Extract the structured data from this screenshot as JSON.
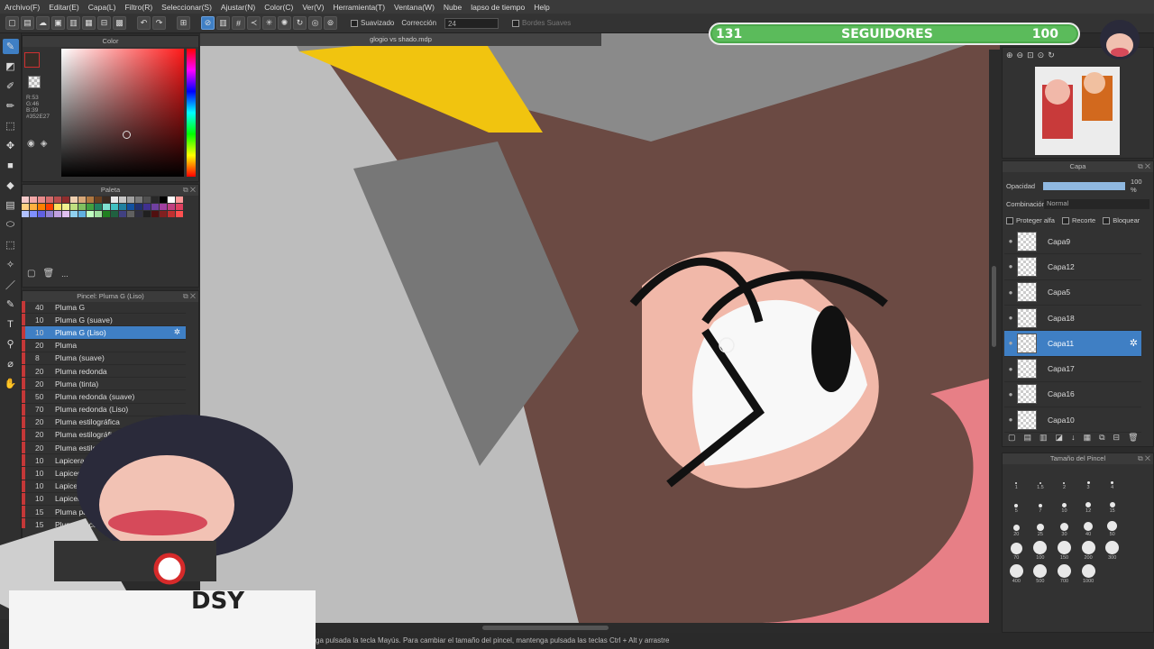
{
  "menu": [
    "Archivo(F)",
    "Editar(E)",
    "Capa(L)",
    "Filtro(R)",
    "Seleccionar(S)",
    "Ajustar(N)",
    "Color(C)",
    "Ver(V)",
    "Herramienta(T)",
    "Ventana(W)",
    "Nube",
    "lapso de tiempo",
    "Help"
  ],
  "command_bar": {
    "smoothing_label": "Suavizado",
    "correction_label": "Corrección",
    "correction_value": "24",
    "soft_edges_label": "Bordes Suaves"
  },
  "color_panel": {
    "title": "Color",
    "readout": [
      "R:53",
      "G:46",
      "B:39",
      "#352E27"
    ],
    "main_color": "#352e27"
  },
  "palette_panel": {
    "title": "Paleta",
    "colors": [
      "#f4c9c9",
      "#f2a8a8",
      "#e88b8b",
      "#d46b6b",
      "#b94d4d",
      "#8f2d2d",
      "#f0d0b0",
      "#d8a878",
      "#b07840",
      "#6a4020",
      "#3a2a20",
      "#e8e8e8",
      "#c8c8c8",
      "#a0a0a0",
      "#787878",
      "#505050",
      "#282828",
      "#000000",
      "#ffffff",
      "#ff9999",
      "#ffd080",
      "#ffb040",
      "#ff8000",
      "#ff4000",
      "#ffe060",
      "#f0f090",
      "#c0e080",
      "#80c060",
      "#40a040",
      "#208060",
      "#80e0d0",
      "#40c0c0",
      "#2080a0",
      "#1050a0",
      "#203070",
      "#403090",
      "#7040a0",
      "#a040a0",
      "#c04080",
      "#e04060",
      "#b0c0ff",
      "#8090ff",
      "#6060e0",
      "#9080d0",
      "#c0a0e0",
      "#e0c0f0",
      "#90d0f0",
      "#60b0e0",
      "#c0ffc0",
      "#a0e0a0",
      "#208020",
      "#206040",
      "#404080",
      "#606060",
      "#303040",
      "#202020",
      "#501010",
      "#802020",
      "#c03030",
      "#ff5050"
    ],
    "more_label": "..."
  },
  "brush_panel": {
    "title": "Pincel: Pluma G (Liso)",
    "items": [
      {
        "size": "40",
        "name": "Pluma G"
      },
      {
        "size": "10",
        "name": "Pluma G (suave)"
      },
      {
        "size": "10",
        "name": "Pluma G (Liso)"
      },
      {
        "size": "20",
        "name": "Pluma"
      },
      {
        "size": "8",
        "name": "Pluma (suave)"
      },
      {
        "size": "20",
        "name": "Pluma redonda"
      },
      {
        "size": "20",
        "name": "Pluma (tinta)"
      },
      {
        "size": "50",
        "name": "Pluma redonda (suave)"
      },
      {
        "size": "70",
        "name": "Pluma redonda (Liso)"
      },
      {
        "size": "20",
        "name": "Pluma estilográfica"
      },
      {
        "size": "20",
        "name": "Pluma estilográfica (suave)"
      },
      {
        "size": "20",
        "name": "Pluma estilográfica (Liso)"
      },
      {
        "size": "10",
        "name": "Lapicera Escolar"
      },
      {
        "size": "10",
        "name": "Lapicera Escolar (Liso)"
      },
      {
        "size": "10",
        "name": "Lapicera"
      },
      {
        "size": "10",
        "name": "Lapicera Pincel"
      },
      {
        "size": "15",
        "name": "Pluma para"
      },
      {
        "size": "15",
        "name": "Pluma pincel"
      }
    ]
  },
  "canvas": {
    "tab_title": "glogio vs shado.mdp"
  },
  "followers": {
    "current": "131",
    "label": "SEGUIDORES",
    "goal": "100",
    "progress": 1.0
  },
  "layer_panel": {
    "title": "Capa",
    "opacity_label": "Opacidad",
    "opacity_value": "100 %",
    "blend_label": "Combinación",
    "blend_value": "Normal",
    "protect_alpha": "Proteger alfa",
    "clip": "Recorte",
    "lock": "Bloquear",
    "layers": [
      "Capa9",
      "Capa12",
      "Capa5",
      "Capa18",
      "Capa11",
      "Capa17",
      "Capa16",
      "Capa10"
    ]
  },
  "brush_size_panel": {
    "title": "Tamaño del Pincel",
    "sizes": [
      "1",
      "1.5",
      "2",
      "3",
      "4",
      "5",
      "7",
      "10",
      "12",
      "15",
      "20",
      "25",
      "30",
      "40",
      "50",
      "70",
      "100",
      "150",
      "200",
      "300",
      "400",
      "500",
      "700",
      "1000"
    ]
  },
  "status": "ga pulsada la tecla Mayús. Para cambiar el tamaño del pincel, mantenga pulsada las teclas Ctrl + Alt y arrastre",
  "sticker_text": "DSY"
}
